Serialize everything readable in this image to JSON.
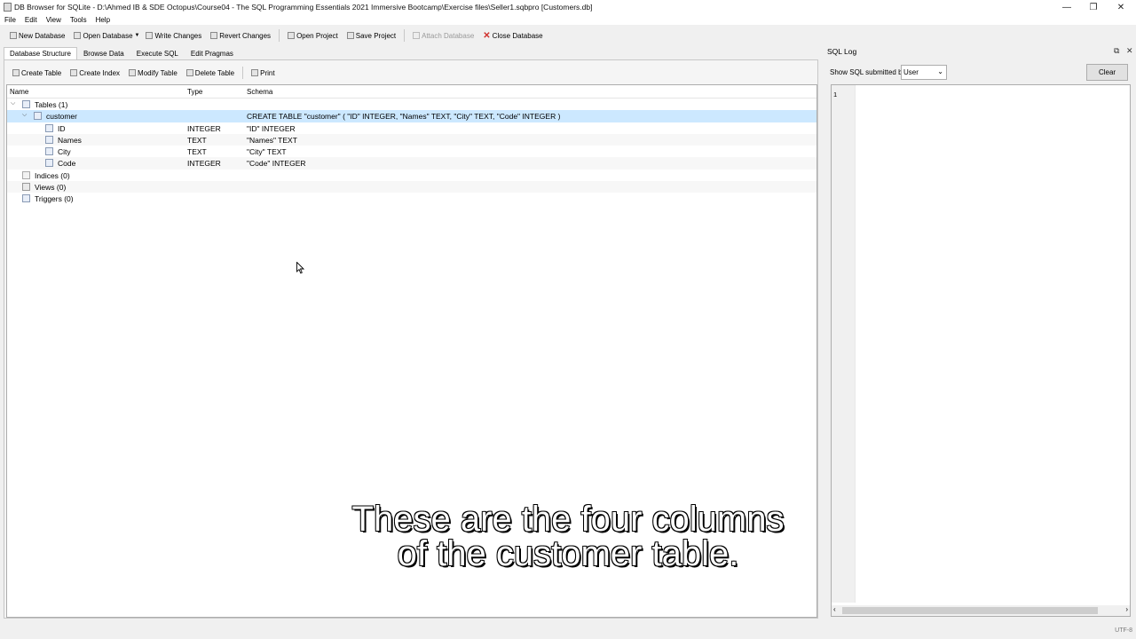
{
  "window": {
    "title": "DB Browser for SQLite - D:\\Ahmed IB & SDE Octopus\\Course04 - The SQL Programming Essentials 2021 Immersive Bootcamp\\Exercise files\\Seller1.sqbpro [Customers.db]",
    "minimize": "—",
    "restore": "❐",
    "close": "✕"
  },
  "menu": [
    "File",
    "Edit",
    "View",
    "Tools",
    "Help"
  ],
  "toolbar": {
    "new_database": "New Database",
    "open_database": "Open Database",
    "write_changes": "Write Changes",
    "revert_changes": "Revert Changes",
    "open_project": "Open Project",
    "save_project": "Save Project",
    "attach_database": "Attach Database",
    "close_database": "Close Database"
  },
  "tabs": [
    "Database Structure",
    "Browse Data",
    "Execute SQL",
    "Edit Pragmas"
  ],
  "structure_toolbar": {
    "create_table": "Create Table",
    "create_index": "Create Index",
    "modify_table": "Modify Table",
    "delete_table": "Delete Table",
    "print": "Print"
  },
  "tree": {
    "headers": {
      "name": "Name",
      "type": "Type",
      "schema": "Schema"
    },
    "tables_group": "Tables (1)",
    "table": {
      "name": "customer",
      "schema": "CREATE TABLE \"customer\" ( \"ID\" INTEGER, \"Names\" TEXT, \"City\" TEXT, \"Code\" INTEGER )"
    },
    "columns": [
      {
        "name": "ID",
        "type": "INTEGER",
        "schema": "\"ID\" INTEGER"
      },
      {
        "name": "Names",
        "type": "TEXT",
        "schema": "\"Names\" TEXT"
      },
      {
        "name": "City",
        "type": "TEXT",
        "schema": "\"City\" TEXT"
      },
      {
        "name": "Code",
        "type": "INTEGER",
        "schema": "\"Code\" INTEGER"
      }
    ],
    "indices_group": "Indices (0)",
    "views_group": "Views (0)",
    "triggers_group": "Triggers (0)"
  },
  "sql_log": {
    "title": "SQL Log",
    "show_label": "Show SQL submitted by",
    "show_value": "User",
    "clear": "Clear",
    "line_number": "1"
  },
  "status": {
    "encoding": "UTF-8"
  },
  "subtitle": {
    "line1": "These are the four columns",
    "line2": "of the customer table."
  }
}
